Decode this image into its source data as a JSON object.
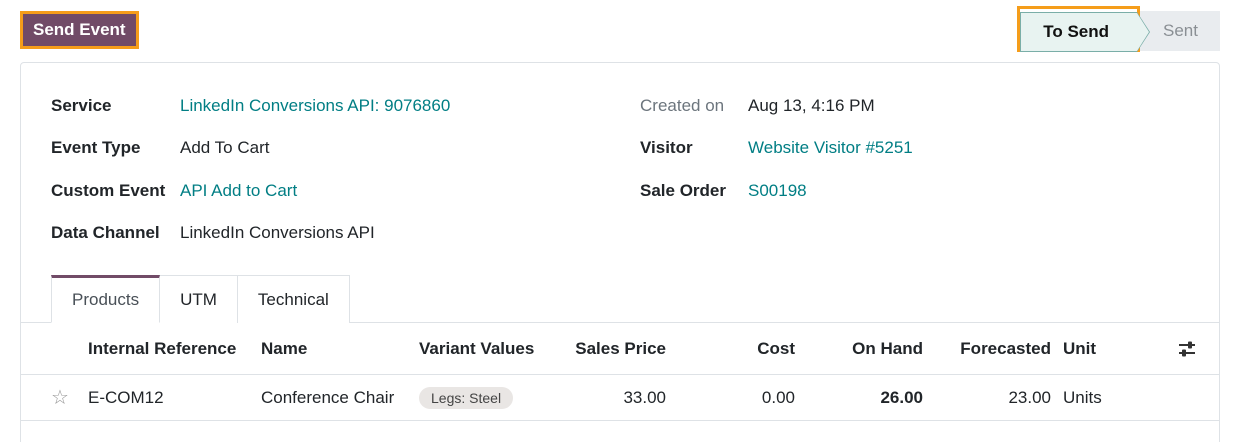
{
  "header": {
    "send_button": "Send Event",
    "status": {
      "active": "To Send",
      "next": "Sent"
    }
  },
  "fields_left": [
    {
      "label": "Service",
      "value": "LinkedIn Conversions API: 9076860",
      "link": true
    },
    {
      "label": "Event Type",
      "value": "Add To Cart",
      "link": false
    },
    {
      "label": "Custom Event",
      "value": "API Add to Cart",
      "link": true
    },
    {
      "label": "Data Channel",
      "value": "LinkedIn Conversions API",
      "link": false
    }
  ],
  "fields_right": [
    {
      "label": "Created on",
      "value": "Aug 13, 4:16 PM",
      "link": false
    },
    {
      "label": "Visitor",
      "value": "Website Visitor #5251",
      "link": true
    },
    {
      "label": "Sale Order",
      "value": "S00198",
      "link": true
    }
  ],
  "tabs": [
    "Products",
    "UTM",
    "Technical"
  ],
  "table": {
    "columns": [
      "Internal Reference",
      "Name",
      "Variant Values",
      "Sales Price",
      "Cost",
      "On Hand",
      "Forecasted",
      "Unit"
    ],
    "rows": [
      {
        "internal_reference": "E-COM12",
        "name": "Conference Chair",
        "variant": "Legs: Steel",
        "sales_price": "33.00",
        "cost": "0.00",
        "on_hand": "26.00",
        "forecasted": "23.00",
        "unit": "Units"
      }
    ]
  },
  "colors": {
    "brand": "#714b67",
    "link": "#017e84",
    "highlight": "#f59d1a"
  }
}
